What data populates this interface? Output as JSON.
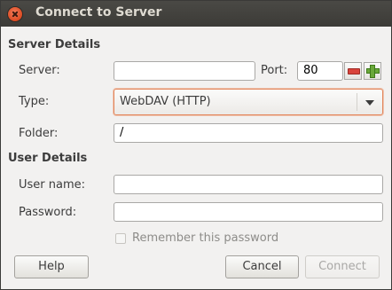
{
  "window": {
    "title": "Connect to Server"
  },
  "sections": {
    "server_details": "Server Details",
    "user_details": "User Details"
  },
  "fields": {
    "server_label": "Server:",
    "server_value": "",
    "port_label": "Port:",
    "port_value": "80",
    "type_label": "Type:",
    "type_value": "WebDAV (HTTP)",
    "folder_label": "Folder:",
    "folder_value": "/",
    "username_label": "User name:",
    "username_value": "",
    "password_label": "Password:",
    "password_value": ""
  },
  "remember": {
    "label": "Remember this password",
    "checked": false
  },
  "buttons": {
    "help": "Help",
    "cancel": "Cancel",
    "connect": "Connect"
  },
  "colors": {
    "focus_ring": "#e3855a",
    "titlebar": "#3c3b37",
    "close": "#dc4a21"
  }
}
